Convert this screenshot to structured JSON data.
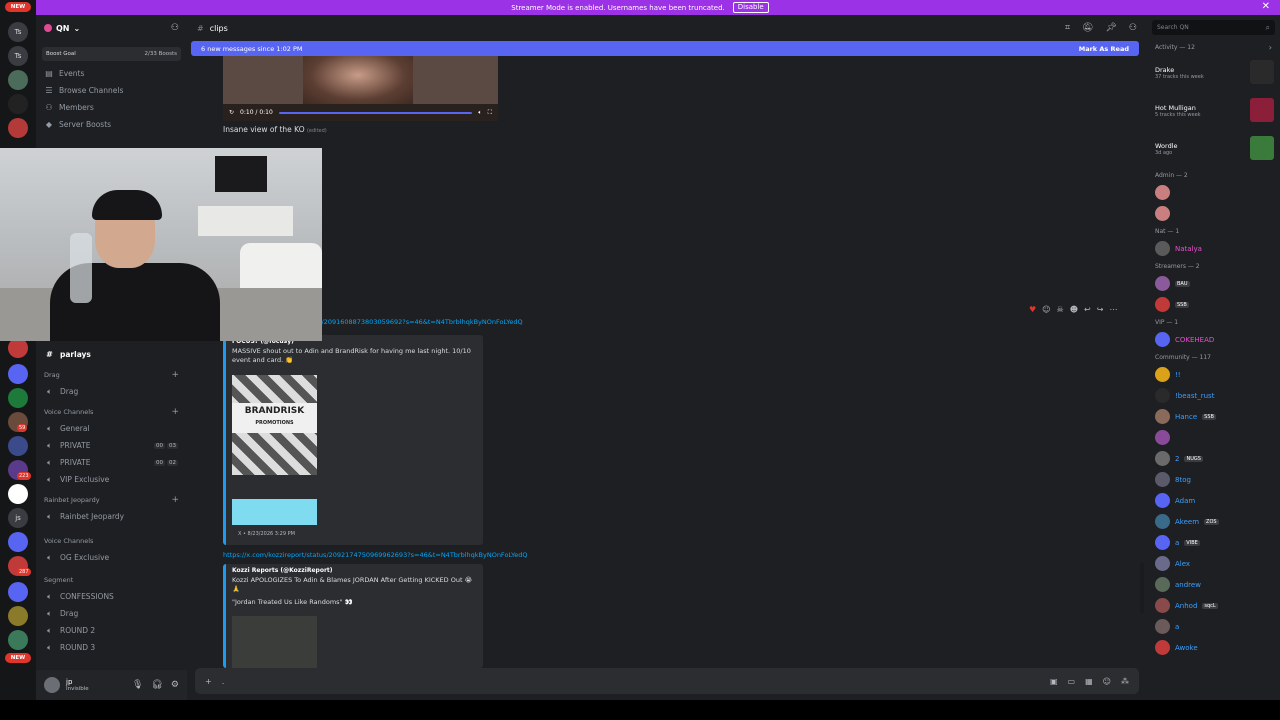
{
  "banner": {
    "text": "Streamer Mode is enabled. Usernames have been truncated.",
    "disable_label": "Disable"
  },
  "rail": {
    "top_badge": "NEW",
    "bottom_badge": "NEW",
    "servers": [
      "Ts",
      "Ts",
      "js"
    ],
    "counts": [
      "59",
      "223",
      "287"
    ]
  },
  "sidebar": {
    "server_name": "QN",
    "boost_label": "Boost Goal",
    "boost_count": "2/33 Boosts",
    "nav": [
      {
        "label": "Events"
      },
      {
        "label": "Browse Channels"
      },
      {
        "label": "Members"
      },
      {
        "label": "Server Boosts"
      }
    ],
    "active_channel": "parlays",
    "sections": [
      {
        "category": "Drag",
        "channels": [
          "Drag"
        ]
      },
      {
        "category": "Voice Channels",
        "channels": [
          "General",
          "PRIVATE",
          "PRIVATE",
          "VIP Exclusive"
        ]
      },
      {
        "category": "Rainbet Jeopardy",
        "channels": [
          "Rainbet Jeopardy"
        ]
      },
      {
        "category": "Voice Channels",
        "channels": [
          "OG Exclusive"
        ]
      },
      {
        "category": "Segment",
        "channels": [
          "CONFESSIONS",
          "Drag",
          "ROUND 2",
          "ROUND 3"
        ]
      }
    ],
    "private_counts": [
      [
        "00",
        "03"
      ],
      [
        "00",
        "02"
      ]
    ],
    "user": {
      "name": "jp",
      "status": "Invisible"
    }
  },
  "main": {
    "channel": "clips",
    "new_messages": "6 new messages since 1:02 PM",
    "mark_read": "Mark As Read",
    "video_time": "0:10 / 0:10",
    "caption": "Insane view of the KO",
    "caption_edited": "(edited)",
    "link1": "…/2091608873803059692?s=46&t=N4TbrblhqkByNOnFoLYedQ",
    "embed1": {
      "author": "FOCUS? (@focusy)",
      "text": "MASSIVE shout out to Adin and BrandRisk for having me last night. 10/10 event and card. 👏",
      "thumb_label": "BRANDRISK",
      "thumb_sub": "PROMOTIONS",
      "footer": "X • 8/23/2026 3:29 PM"
    },
    "link2": "https://x.com/kozzireport/status/2092174750969962693?s=46&t=N4TbrblhqkByNOnFoLYedQ",
    "embed2": {
      "author": "Kozzi Reports (@KozziReport)",
      "text1": "Kozzi APOLOGIZES To Adin & Blames JORDAN After Getting KICKED Out 😭🙏",
      "text2": "\"Jordan Treated Us Like Randoms\" 👀"
    },
    "input_placeholder": "."
  },
  "right": {
    "search_placeholder": "Search QN",
    "activity_header": "Activity — 12",
    "activities": [
      {
        "title": "Drake",
        "sub": "37 tracks this week",
        "art": "#2a2a2a"
      },
      {
        "title": "Hot Mulligan",
        "sub": "5 tracks this week",
        "art": "#8b1f3a"
      },
      {
        "title": "Wordle",
        "sub": "3d ago",
        "art": "#3a7a3a"
      }
    ],
    "groups": [
      {
        "header": "Admin — 2",
        "members": [
          {
            "name": "",
            "color": "#c97f7f"
          },
          {
            "name": "",
            "color": "#c97f7f"
          }
        ]
      },
      {
        "header": "Nat — 1",
        "members": [
          {
            "name": "Natalya",
            "color": "#e84fd1"
          }
        ]
      },
      {
        "header": "Streamers — 2",
        "members": [
          {
            "name": "",
            "color": "#e84fd1",
            "tag": "BAU"
          },
          {
            "name": "",
            "color": "#e84fd1",
            "tag": "SSB"
          }
        ]
      },
      {
        "header": "VIP — 1",
        "members": [
          {
            "name": "COKEHEAD",
            "color": "#e84fd1"
          }
        ]
      },
      {
        "header": "Community — 117",
        "members": [
          {
            "name": "!!",
            "color": "#3ba0ff"
          },
          {
            "name": "!beast_rust",
            "color": "#3ba0ff"
          },
          {
            "name": "Hance",
            "color": "#3ba0ff",
            "tag": "SSB"
          },
          {
            "name": "",
            "color": "#8a6bff"
          },
          {
            "name": "2",
            "color": "#3ba0ff",
            "tag": "NUGS"
          },
          {
            "name": "8tog",
            "color": "#3ba0ff"
          },
          {
            "name": "Adam",
            "color": "#3ba0ff"
          },
          {
            "name": "Akeem",
            "color": "#3ba0ff",
            "tag": "ZOS"
          },
          {
            "name": "a",
            "color": "#3ba0ff",
            "tag": "VIBE"
          },
          {
            "name": "Alex",
            "color": "#3ba0ff"
          },
          {
            "name": "andrew",
            "color": "#3ba0ff"
          },
          {
            "name": "Anhod",
            "color": "#3ba0ff",
            "tag": "sqcL"
          },
          {
            "name": "a",
            "color": "#3ba0ff"
          },
          {
            "name": "Awoke",
            "color": "#3ba0ff"
          }
        ]
      }
    ]
  }
}
